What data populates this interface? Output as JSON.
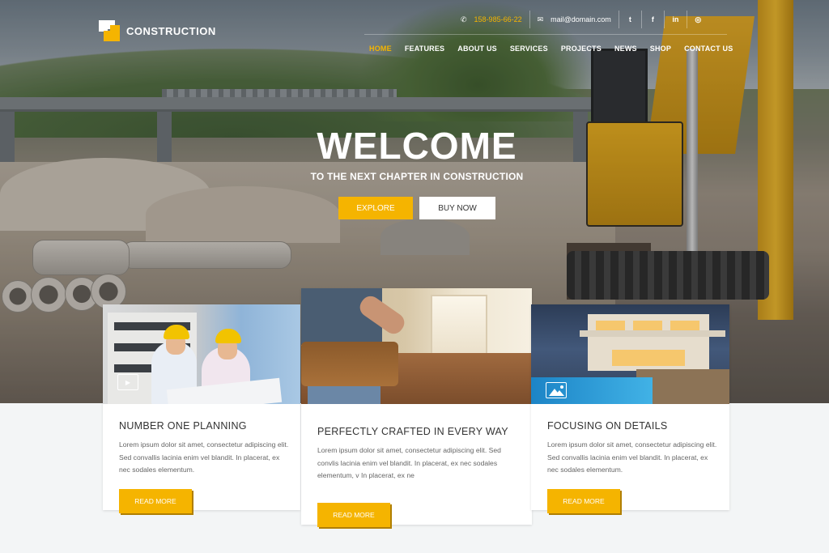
{
  "brand": {
    "name": "CONSTRUCTION"
  },
  "topbar": {
    "phone": "158-985-66-22",
    "email": "mail@domain.com",
    "social": [
      {
        "icon": "twitter-icon",
        "glyph": "t"
      },
      {
        "icon": "facebook-icon",
        "glyph": "f"
      },
      {
        "icon": "linkedin-icon",
        "glyph": "in"
      },
      {
        "icon": "dribbble-icon",
        "glyph": "◎"
      }
    ]
  },
  "nav": {
    "items": [
      {
        "label": "HOME",
        "active": true
      },
      {
        "label": "FEATURES"
      },
      {
        "label": "ABOUT US"
      },
      {
        "label": "SERVICES"
      },
      {
        "label": "PROJECTS"
      },
      {
        "label": "NEWS"
      },
      {
        "label": "SHOP"
      },
      {
        "label": "CONTACT US"
      }
    ]
  },
  "hero": {
    "title": "WELCOME",
    "subtitle": "TO THE NEXT CHAPTER IN CONSTRUCTION",
    "primary_button": "EXPLORE",
    "secondary_button": "BUY NOW"
  },
  "cards": [
    {
      "title": "NUMBER ONE PLANNING",
      "text": "Lorem ipsum dolor sit amet, consectetur adipiscing elit. Sed convallis lacinia enim vel blandit. In placerat, ex nec sodales elementum.",
      "button": "READ MORE",
      "media_icon": "video-icon"
    },
    {
      "title": "PERFECTLY CRAFTED IN EVERY WAY",
      "text": "Lorem ipsum dolor sit amet, consectetur adipiscing elit. Sed convlis lacinia enim vel blandit. In placerat, ex nec sodales elementum, v In placerat, ex ne",
      "button": "READ MORE"
    },
    {
      "title": "FOCUSING ON DETAILS",
      "text": "Lorem ipsum dolor sit amet, consectetur adipiscing elit. Sed convallis lacinia enim vel blandit. In placerat, ex nec sodales elementum.",
      "button": "READ MORE",
      "media_icon": "image-icon"
    }
  ],
  "colors": {
    "accent": "#f5b400",
    "text": "#333333",
    "muted": "#666666"
  }
}
